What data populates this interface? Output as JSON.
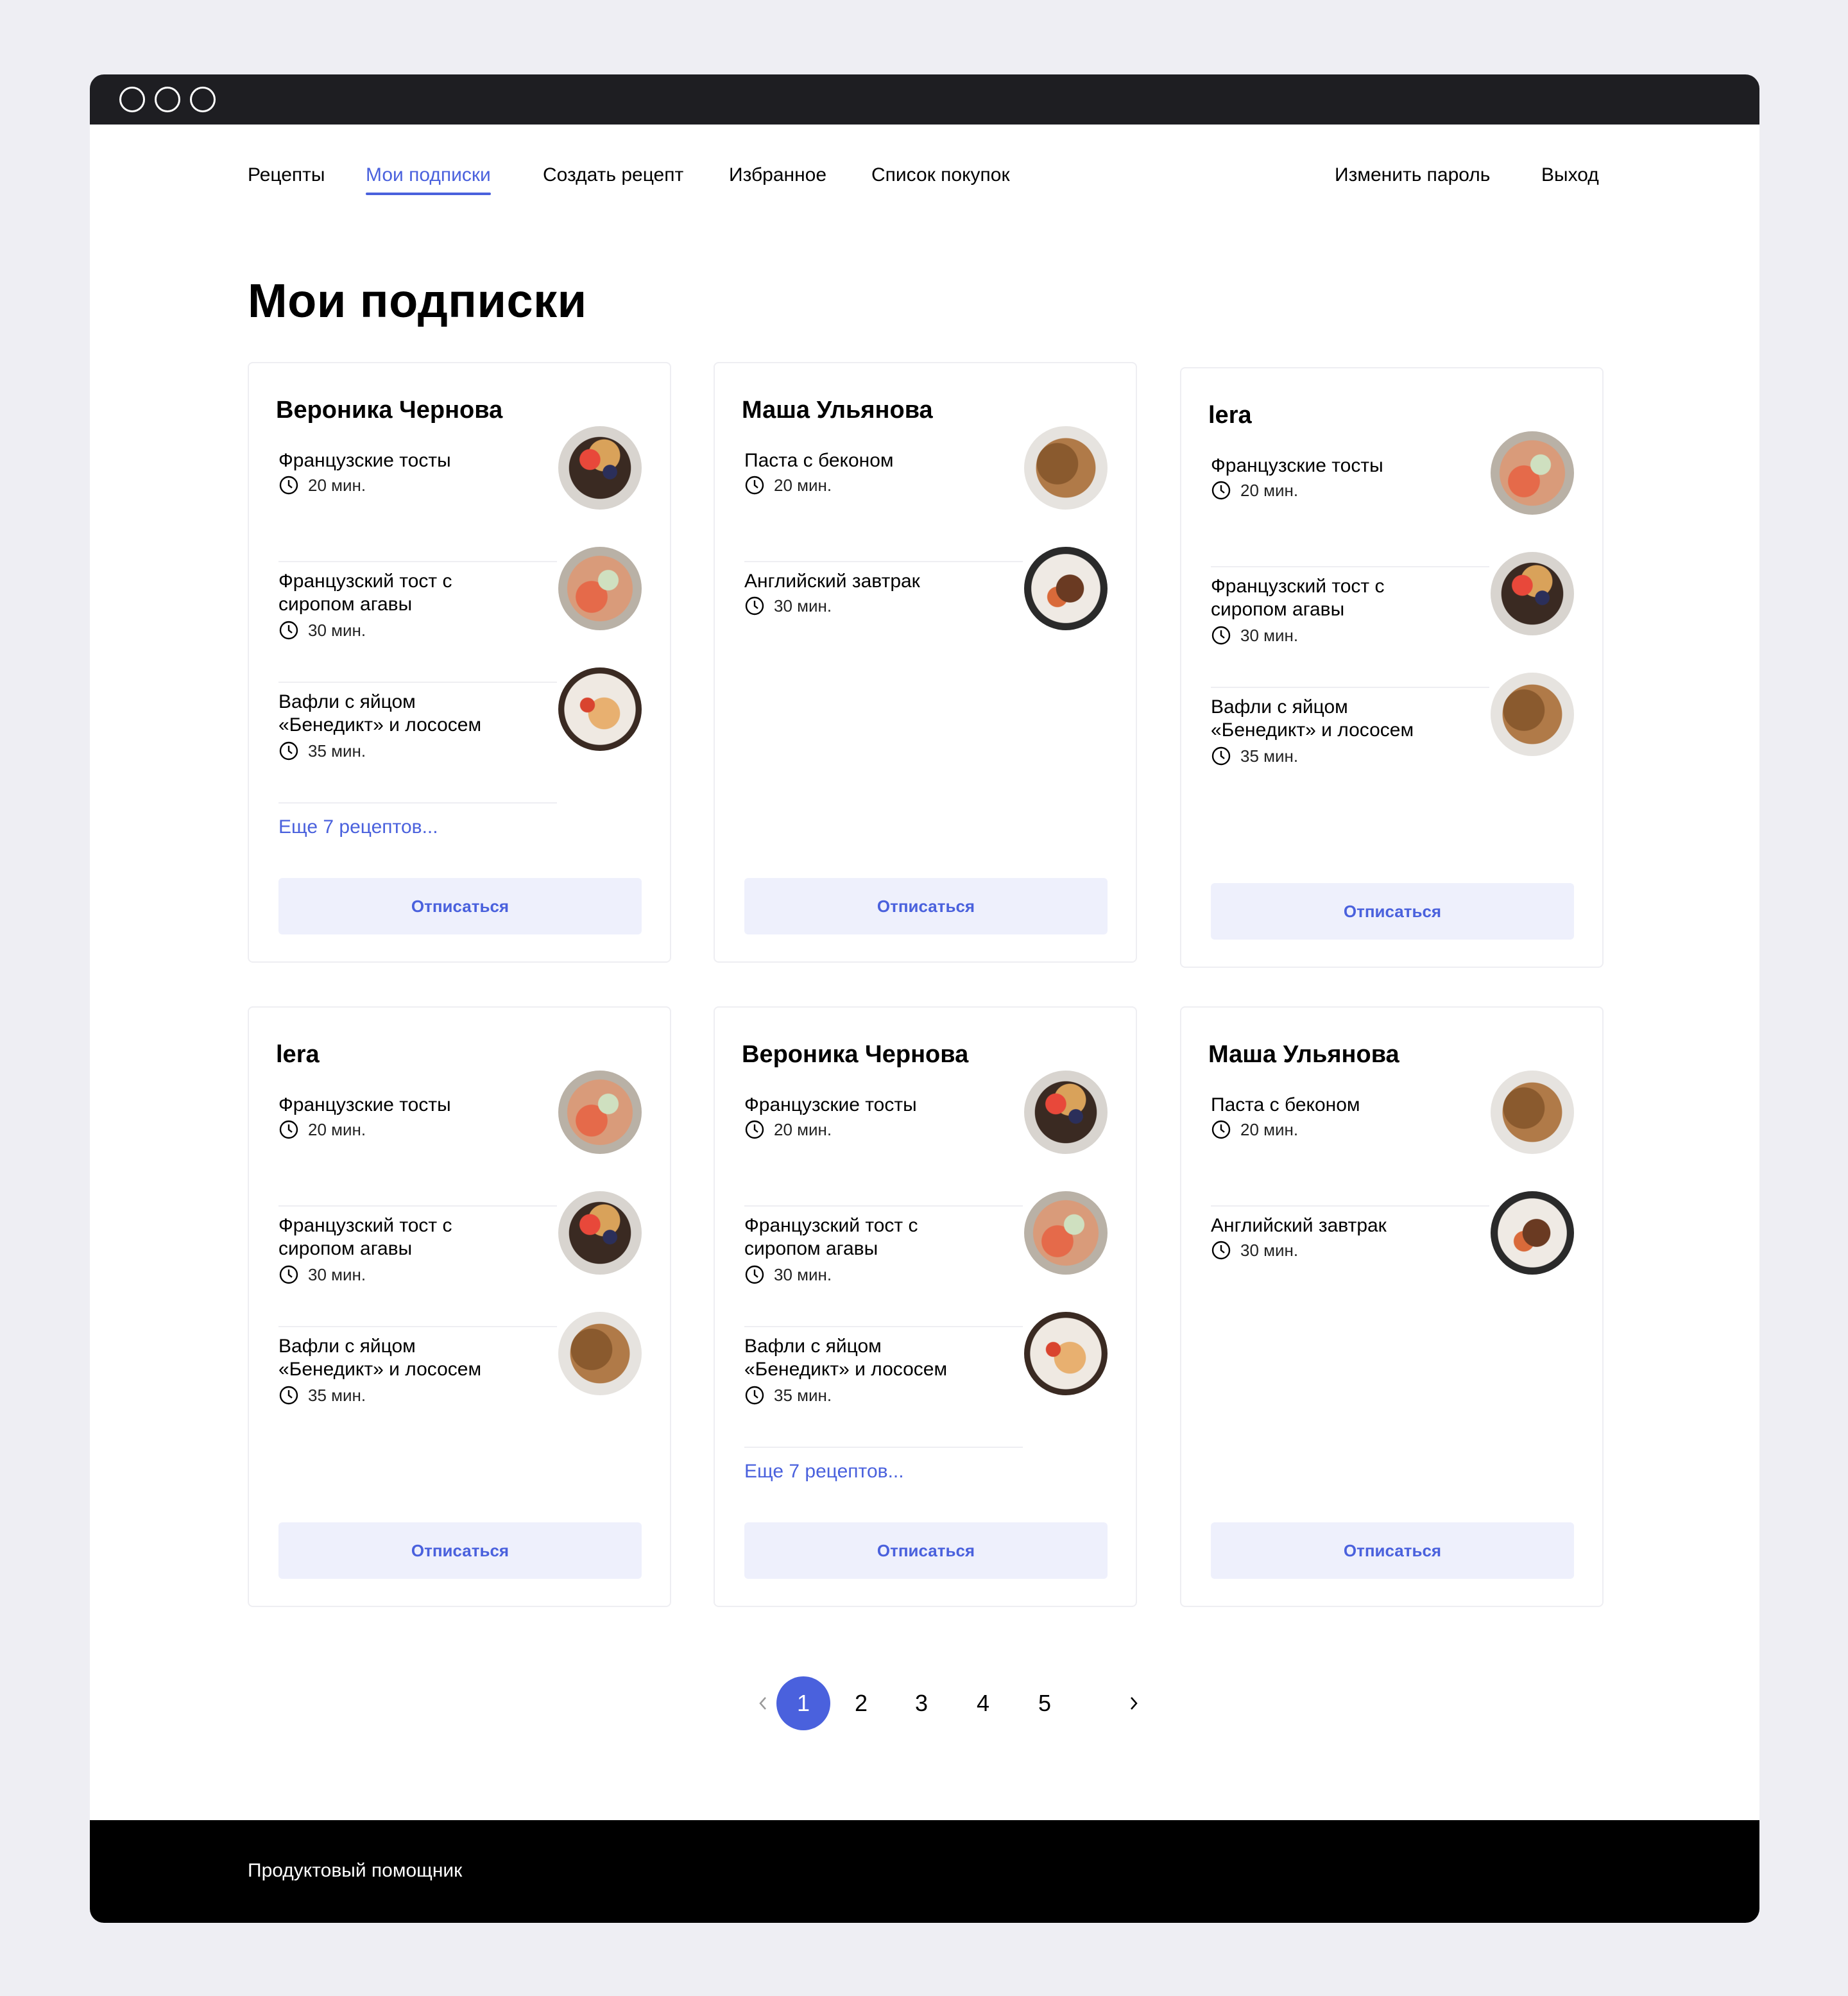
{
  "nav": {
    "recipes": "Рецепты",
    "subscriptions": "Мои подписки",
    "create": "Создать рецепт",
    "favorites": "Избранное",
    "shopping": "Список покупок",
    "change_password": "Изменить пароль",
    "logout": "Выход"
  },
  "page_title": "Мои подписки",
  "cards": [
    {
      "author": "Вероника Чернова",
      "recipes": [
        {
          "name": "Французские тосты",
          "time": "20 мин."
        },
        {
          "name": "Французский тост с сиропом агавы",
          "time": "30 мин."
        },
        {
          "name": "Вафли с яйцом «Бенедикт» и лососем",
          "time": "35 мин."
        }
      ],
      "more": "Еще 7 рецептов...",
      "unsubscribe": "Отписаться"
    },
    {
      "author": "Маша  Ульянова",
      "recipes": [
        {
          "name": "Паста с беконом",
          "time": "20 мин."
        },
        {
          "name": "Английский завтрак",
          "time": "30 мин."
        }
      ],
      "more": "",
      "unsubscribe": "Отписаться"
    },
    {
      "author": "lera",
      "recipes": [
        {
          "name": "Французские тосты",
          "time": "20 мин."
        },
        {
          "name": "Французский тост с сиропом агавы",
          "time": "30 мин."
        },
        {
          "name": "Вафли с яйцом «Бенедикт» и лососем",
          "time": "35 мин."
        }
      ],
      "more": "",
      "unsubscribe": "Отписаться"
    },
    {
      "author": "lera",
      "recipes": [
        {
          "name": "Французские тосты",
          "time": "20 мин."
        },
        {
          "name": "Французский тост с сиропом агавы",
          "time": "30 мин."
        },
        {
          "name": "Вафли с яйцом «Бенедикт» и лососем",
          "time": "35 мин."
        }
      ],
      "more": "",
      "unsubscribe": "Отписаться"
    },
    {
      "author": "Вероника Чернова",
      "recipes": [
        {
          "name": "Французские тосты",
          "time": "20 мин."
        },
        {
          "name": "Французский тост с сиропом агавы",
          "time": "30 мин."
        },
        {
          "name": "Вафли с яйцом «Бенедикт» и лососем",
          "time": "35 мин."
        }
      ],
      "more": "Еще 7 рецептов...",
      "unsubscribe": "Отписаться"
    },
    {
      "author": "Маша  Ульянова",
      "recipes": [
        {
          "name": "Паста с беконом",
          "time": "20 мин."
        },
        {
          "name": "Английский завтрак",
          "time": "30 мин."
        }
      ],
      "more": "",
      "unsubscribe": "Отписаться"
    }
  ],
  "pagination": {
    "prev_icon": "chevron-left-icon",
    "pages": [
      "1",
      "2",
      "3",
      "4",
      "5"
    ],
    "current": "1",
    "next_icon": "chevron-right-icon"
  },
  "footer": {
    "text": "Продуктовый помощник"
  },
  "colors": {
    "accent": "#4a61dd",
    "button_bg": "#eef0fc",
    "titlebar": "#1e1e22",
    "footer": "#000000"
  }
}
